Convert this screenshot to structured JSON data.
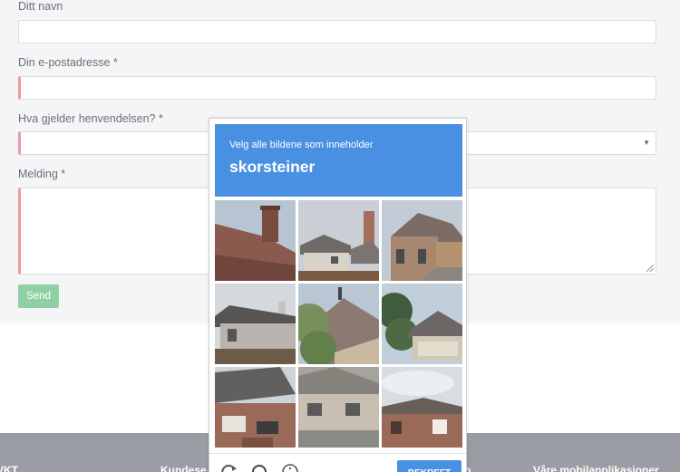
{
  "form": {
    "name_label": "Ditt navn",
    "email_label": "Din e-postadresse *",
    "subject_label": "Hva gjelder henvendelsen? *",
    "message_label": "Melding *",
    "send_label": "Send"
  },
  "footer": {
    "col1": "VKT",
    "col2": "Kundese",
    "col3": "o",
    "col4": "Våre mobilapplikasjoner"
  },
  "captcha": {
    "instruction": "Velg alle bildene som inneholder",
    "target_word": "skorsteiner",
    "verify_label": "BEKREFT",
    "icons": [
      "reload-icon",
      "headphones-icon",
      "info-icon"
    ],
    "tile_count": 9
  },
  "colors": {
    "captcha_blue": "#4a90e2",
    "send_green": "#8fd1a5",
    "required_marker": "#e89aa2",
    "footer_gray": "#9a9da3"
  }
}
